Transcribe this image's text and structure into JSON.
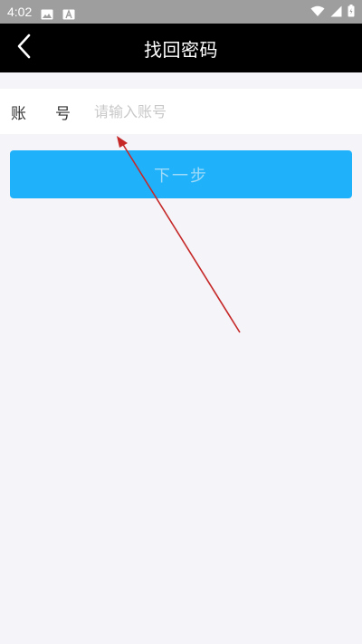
{
  "status_bar": {
    "time": "4:02",
    "icons_left": [
      "image-icon",
      "a-icon"
    ],
    "icons_right": [
      "wifi-icon",
      "signal-icon",
      "battery-icon"
    ]
  },
  "header": {
    "title": "找回密码",
    "back_icon": "chevron-left-icon"
  },
  "form": {
    "account_label_part1": "账",
    "account_label_part2": "号",
    "account_placeholder": "请输入账号",
    "account_value": ""
  },
  "actions": {
    "next_label": "下一步"
  },
  "colors": {
    "header_bg": "#000000",
    "button_bg": "#1fb2fa",
    "button_text": "#9fdaf8",
    "page_bg": "#f4f4f9",
    "annotation_arrow": "#c62828"
  }
}
